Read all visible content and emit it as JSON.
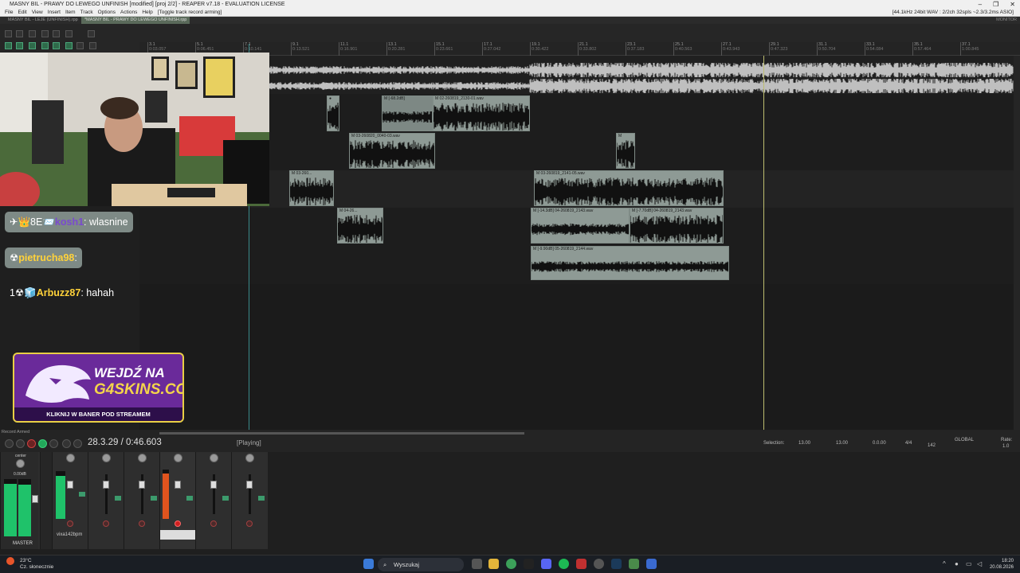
{
  "window": {
    "title": "MASNY BIL - PRAWY DO LEWEGO UNFINISH [modified] [proj 2/2] - REAPER v7.18 - EVALUATION LICENSE",
    "format": "[44.1kHz 24bit WAV : 2/2ch 32spls ~2.3/3.2ms ASIO]"
  },
  "menu": {
    "items": [
      "File",
      "Edit",
      "View",
      "Insert",
      "Item",
      "Track",
      "Options",
      "Actions",
      "Help"
    ],
    "extra": "[Toggle track record arming]"
  },
  "tabs": [
    "MASNY BIL - LEJE (UNFINISH).rpp",
    "*MASNY BIL - PRAWY DO LEWEGO UNFINISH.rpp"
  ],
  "monitor_label": "MONITOR",
  "ruler": [
    {
      "bar": "3.1",
      "time": "0:03.057"
    },
    {
      "bar": "5.1",
      "time": "0:06.451"
    },
    {
      "bar": "7.1",
      "time": "0:10.141"
    },
    {
      "bar": "9.1",
      "time": "0:13.521"
    },
    {
      "bar": "11.1",
      "time": "0:16.901"
    },
    {
      "bar": "13.1",
      "time": "0:20.281"
    },
    {
      "bar": "15.1",
      "time": "0:23.661"
    },
    {
      "bar": "17.1",
      "time": "0:27.042"
    },
    {
      "bar": "19.1",
      "time": "0:30.422"
    },
    {
      "bar": "21.1",
      "time": "0:33.802"
    },
    {
      "bar": "23.1",
      "time": "0:37.183"
    },
    {
      "bar": "25.1",
      "time": "0:40.563"
    },
    {
      "bar": "27.1",
      "time": "0:43.943"
    },
    {
      "bar": "29.1",
      "time": "0:47.323"
    },
    {
      "bar": "31.1",
      "time": "0:50.704"
    },
    {
      "bar": "33.1",
      "time": "0:54.084"
    },
    {
      "bar": "35.1",
      "time": "0:57.464"
    },
    {
      "bar": "37.1",
      "time": "1:00.845"
    }
  ],
  "items": {
    "i2a": "M  [-68.2dB]",
    "i2b": "M  02-260819_2130-01.wav",
    "i3": "M  03-260820_0040-03.wav",
    "i3b": "M",
    "i4a": "M  03-260...",
    "i4b": "M  03-260819_2141-05.wav",
    "i5a": "M  04-26...",
    "i5b": "M  [-14.3dB]  04-260819_2143.wav",
    "i5c": "M  [-7.70dB]  04-260819_2143.wav",
    "i6": "M  [-9.90dB]  05-260819_2144.wav"
  },
  "chat": [
    {
      "user": "kosh1",
      "msg": ": wlasnine",
      "prefix": "✈👑8E📨"
    },
    {
      "user": "pietrucha98",
      "msg": ":",
      "prefix": "☢"
    },
    {
      "user": "Arbuzz87",
      "msg": ": hahah",
      "prefix": "1☢🧊"
    }
  ],
  "banner": {
    "line1": "WEJDŹ NA",
    "line2": "G4SKINS.COM",
    "bottom": "KLIKNIJ W BANER POD STREAMEM"
  },
  "transport": {
    "record_armed": "Record Armed",
    "time": "28.3.29 / 0:46.603",
    "state": "[Playing]"
  },
  "selection": {
    "label": "Selection:",
    "start": "13.00",
    "end": "13.00",
    "length": "0.0.00",
    "timesig": "4/4",
    "bpm": "142",
    "global": "GLOBAL",
    "rate_label": "Rate:",
    "rate": "1.0"
  },
  "mixer": {
    "master": "MASTER",
    "track": "vixa142bpm",
    "center": "center",
    "peak": "0.00dB"
  },
  "taskbar": {
    "weather_temp": "23°C",
    "weather_desc": "Cz. słonecznie",
    "search": "Wyszukaj",
    "time": "18:20",
    "date": "20.08.2026"
  },
  "colors": {
    "accent": "#1fc26a",
    "item": "#8e9a95",
    "playhead": "#bdbd70",
    "banner": "#6a2a9a"
  }
}
